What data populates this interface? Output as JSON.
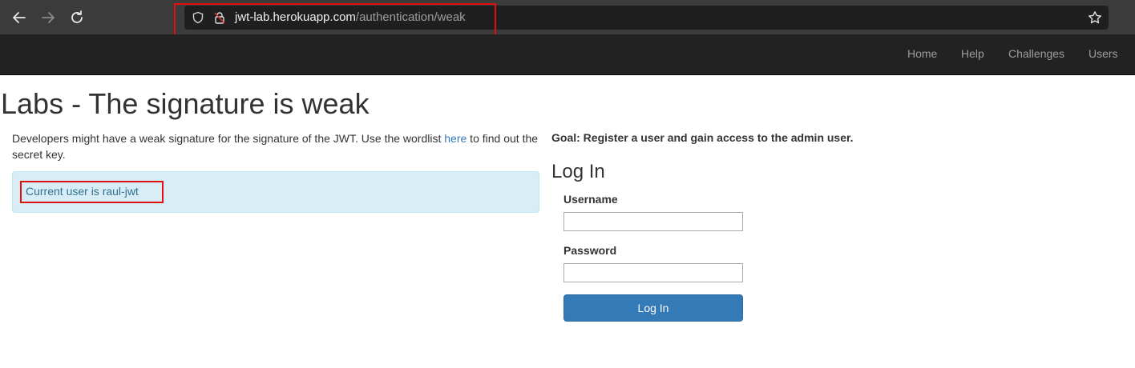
{
  "browser": {
    "url_host": "jwt-lab.herokuapp.com",
    "url_path": "/authentication/weak",
    "highlight_color": "#e01010"
  },
  "icons": {
    "back": "arrow-left-icon",
    "forward": "arrow-right-icon",
    "reload": "reload-icon",
    "tracking": "shield-icon",
    "security": "lock-icon",
    "bookmark": "star-icon"
  },
  "navbar": {
    "items": [
      "Home",
      "Help",
      "Challenges",
      "Users"
    ]
  },
  "page": {
    "title": "Labs - The signature is weak",
    "intro_before": "Developers might have a weak signature for the signature of the JWT. Use the wordlist ",
    "intro_link": "here",
    "intro_after": " to find out the secret key.",
    "alert": "Current user is raul-jwt",
    "goal": "Goal: Register a user and gain access to the admin user."
  },
  "login": {
    "title": "Log In",
    "username_label": "Username",
    "username_value": "",
    "password_label": "Password",
    "password_value": "",
    "button_label": "Log In",
    "button_color": "#337ab7"
  }
}
